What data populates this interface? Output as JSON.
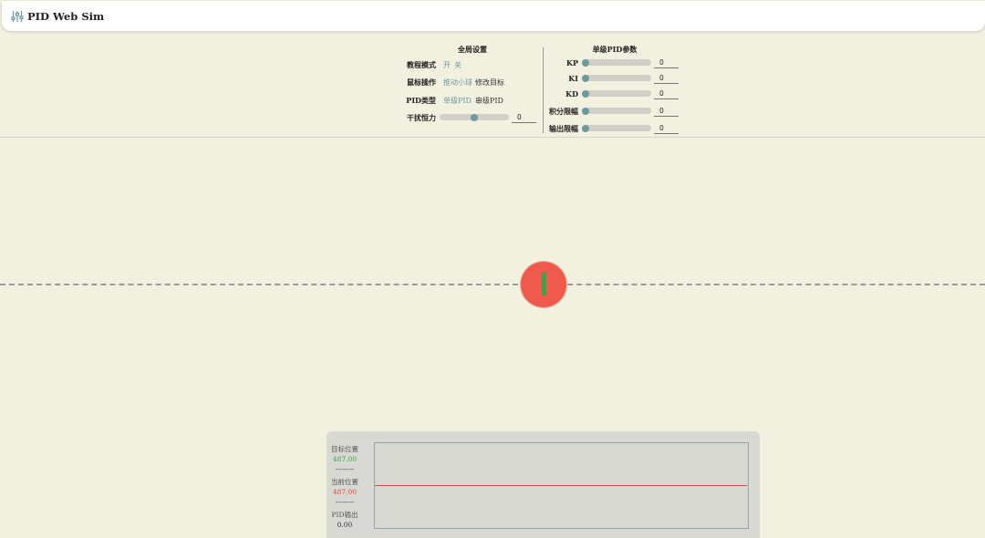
{
  "app": {
    "title": "PID Web Sim",
    "logo_icon": "sliders-icon"
  },
  "global_settings": {
    "title": "全局设置",
    "tutorial_mode": {
      "label": "教程模式",
      "options": [
        "开",
        "关"
      ],
      "selected": "关"
    },
    "mouse_operation": {
      "label": "鼠标操作",
      "options": [
        "推动小球",
        "修改目标"
      ],
      "selected": "推动小球"
    },
    "pid_type": {
      "label": "PID类型",
      "options": [
        "单级PID",
        "串级PID"
      ],
      "selected": "单级PID"
    },
    "disturbance": {
      "label": "干扰恒力",
      "value": "0",
      "slider_fraction": 0.5
    }
  },
  "pid_params": {
    "title": "单级PID参数",
    "items": [
      {
        "label": "KP",
        "value": "0",
        "slider_fraction": 0
      },
      {
        "label": "KI",
        "value": "0",
        "slider_fraction": 0
      },
      {
        "label": "KD",
        "value": "0",
        "slider_fraction": 0
      },
      {
        "label": "积分限幅",
        "value": "0",
        "slider_fraction": 0
      },
      {
        "label": "输出限幅",
        "value": "0",
        "slider_fraction": 0
      }
    ]
  },
  "stats": {
    "target_label": "目标位置",
    "target_value": "487.00",
    "separator": "--------",
    "current_label": "当前位置",
    "current_value": "487.00",
    "output_label": "PID输出",
    "output_value": "0.00"
  },
  "colors": {
    "accent": "#6c9aa0",
    "ball": "#ef5a4c",
    "stick": "#3aa24a",
    "target": "#3da440",
    "current": "#e04a3d",
    "background": "#f2f1df"
  }
}
